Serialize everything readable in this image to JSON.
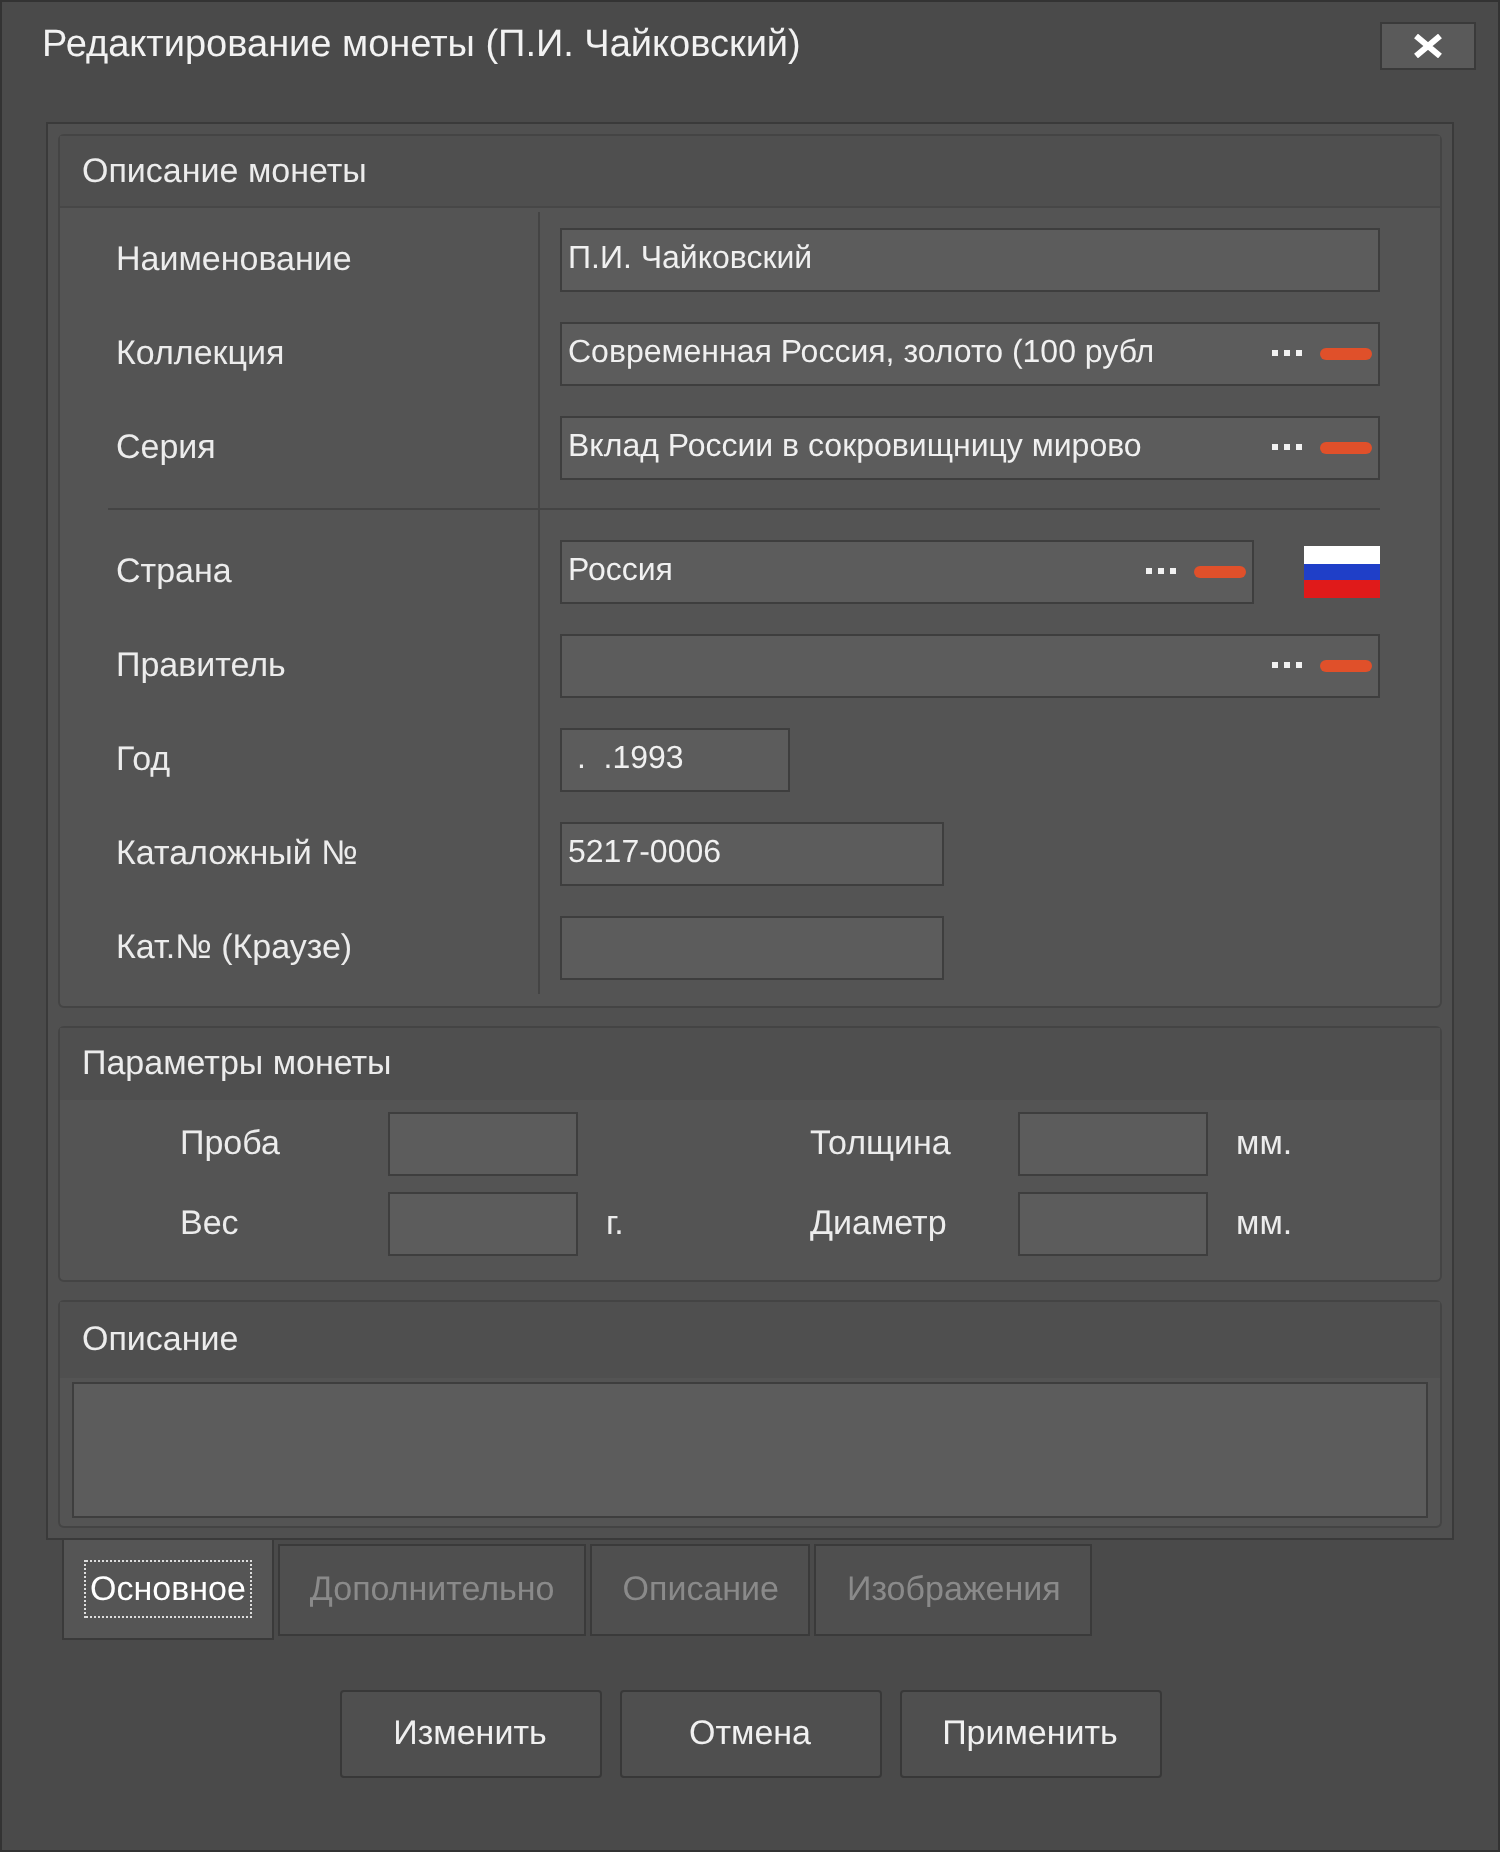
{
  "window": {
    "title": "Редактирование монеты (П.И. Чайковский)"
  },
  "coin_description": {
    "title": "Описание монеты",
    "sections": [
      [
        {
          "label": "Наименование",
          "value": "П.И. Чайковский",
          "kind": "text"
        },
        {
          "label": "Коллекция",
          "value": "Современная Россия, золото (100 рубл",
          "kind": "lookup"
        },
        {
          "label": "Серия",
          "value": "Вклад России в сокровищницу мирово",
          "kind": "lookup"
        }
      ],
      [
        {
          "label": "Страна",
          "value": "Россия",
          "kind": "lookup_flag"
        },
        {
          "label": "Правитель",
          "kind": "lookup"
        },
        {
          "label": "Год",
          "value": " .  .1993",
          "kind": "short"
        },
        {
          "label": "Каталожный №",
          "value": "5217-0006",
          "kind": "medium"
        },
        {
          "label": "Кат.№ (Краузе)",
          "kind": "medium"
        }
      ]
    ]
  },
  "coin_parameters": {
    "title": "Параметры монеты",
    "fields": [
      {
        "label": "Проба"
      },
      {
        "label": "Толщина",
        "unit": "мм."
      },
      {
        "label": "Вес",
        "unit": "г."
      },
      {
        "label": "Диаметр",
        "unit": "мм."
      }
    ]
  },
  "description": {
    "title": "Описание"
  },
  "tabs": [
    {
      "label": "Основное",
      "selected": true
    },
    {
      "label": "Дополнительно",
      "selected": false
    },
    {
      "label": "Описание",
      "selected": false
    },
    {
      "label": "Изображения",
      "selected": false
    }
  ],
  "buttons": [
    "Изменить",
    "Отмена",
    "Применить"
  ]
}
